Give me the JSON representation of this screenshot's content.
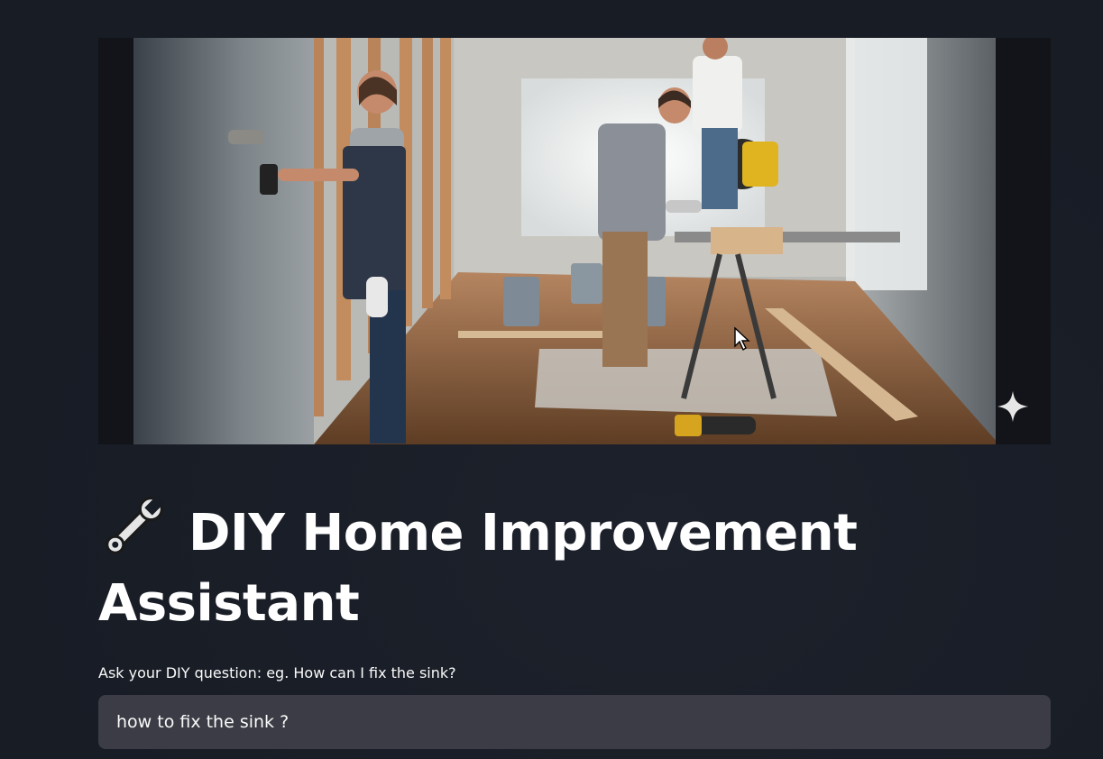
{
  "header": {
    "title": "DIY Home Improvement Assistant",
    "title_icon": "wrench-icon"
  },
  "hero": {
    "image": "photo of people doing home renovation",
    "badge_icon": "sparkle-icon"
  },
  "question": {
    "label": "Ask your DIY question: eg. How can I fix the sink?",
    "value": "how to fix the sink ?"
  },
  "colors": {
    "background": "#181c25",
    "input_background": "#3b3c45",
    "text": "#fafafa"
  }
}
